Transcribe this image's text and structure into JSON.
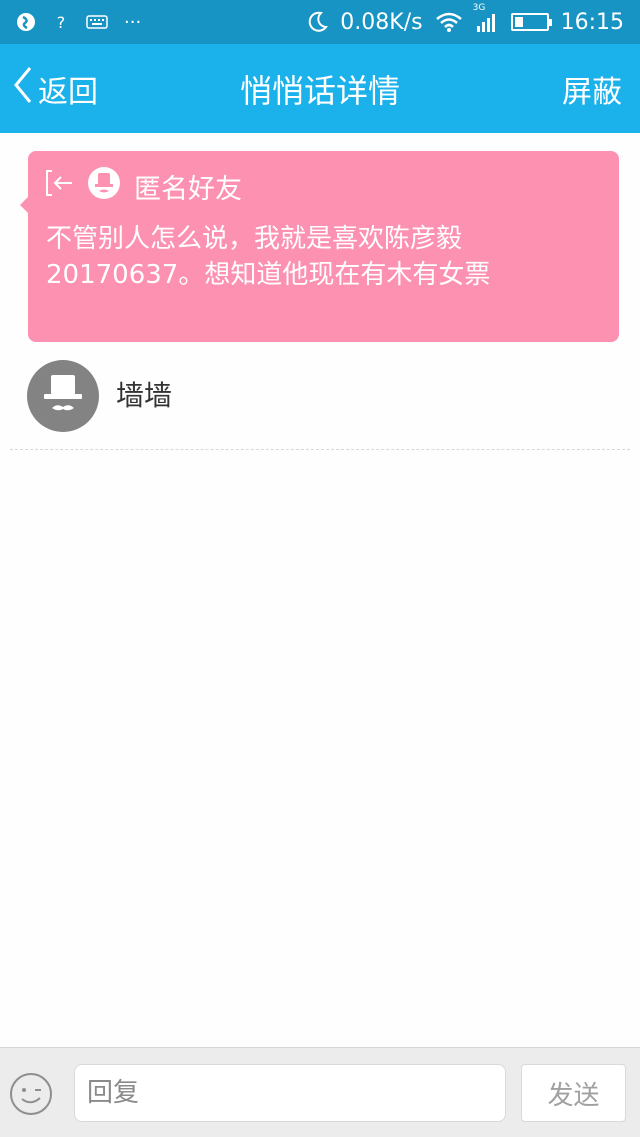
{
  "status_bar": {
    "network_speed": "0.08K/s",
    "network_type": "3G",
    "time": "16:15",
    "icons": [
      "app-notify-icon",
      "question-icon",
      "keyboard-icon",
      "more-icon",
      "moon-icon",
      "wifi-icon",
      "signal-icon",
      "battery-icon"
    ],
    "left_more": "···"
  },
  "header": {
    "back_label": "返回",
    "title": "悄悄话详情",
    "block_label": "屏蔽"
  },
  "message": {
    "sender": "匿名好友",
    "text": "不管别人怎么说，我就是喜欢陈彦毅20170637。想知道他现在有木有女票",
    "card_color": "#fd91b2"
  },
  "comments": [
    {
      "name": "墙墙"
    }
  ],
  "input_bar": {
    "placeholder": "回复",
    "send_label": "发送"
  },
  "colors": {
    "status_bar": "#1793c4",
    "title_bar": "#1bb1ea"
  }
}
